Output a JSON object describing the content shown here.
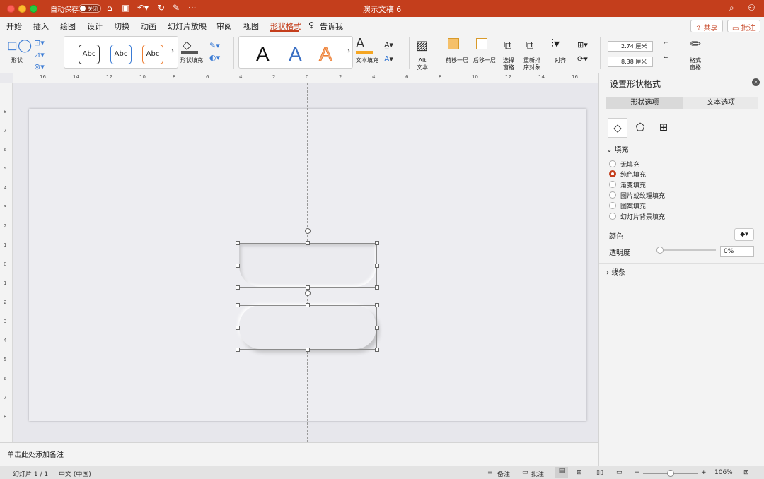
{
  "titlebar": {
    "autosave_label": "自动保存",
    "toggle_text": "关闭",
    "doc_title": "演示文稿 6",
    "more": "···"
  },
  "menu": {
    "tabs": [
      "开始",
      "插入",
      "绘图",
      "设计",
      "切换",
      "动画",
      "幻灯片放映",
      "审阅",
      "视图",
      "形状格式"
    ],
    "tell_me": "告诉我",
    "share": "共享",
    "comments": "批注"
  },
  "ribbon": {
    "shape_label": "形状",
    "style_samples": [
      "Abc",
      "Abc",
      "Abc"
    ],
    "shape_fill": "形状填充",
    "wordart": [
      "A",
      "A",
      "A"
    ],
    "text_fill": "文本填充",
    "alt_text": "Alt\n文本",
    "bring_forward": "前移一层",
    "send_backward": "后移一层",
    "selection_pane": "选择\n窗格",
    "reorder": "重新排\n序对象",
    "align": "对齐",
    "height": "2.74 厘米",
    "width": "8.38 厘米",
    "format_pane": "格式\n窗格"
  },
  "ruler": {
    "h_ticks": [
      "16",
      "14",
      "12",
      "10",
      "8",
      "6",
      "4",
      "2",
      "0",
      "2",
      "4",
      "6",
      "8",
      "10",
      "12",
      "14",
      "16"
    ],
    "v_ticks": [
      "8",
      "7",
      "6",
      "5",
      "4",
      "3",
      "2",
      "1",
      "0",
      "1",
      "2",
      "3",
      "4",
      "5",
      "6",
      "7",
      "8"
    ]
  },
  "notes_placeholder": "单击此处添加备注",
  "status": {
    "slide": "幻灯片 1 / 1",
    "lang": "中文 (中国)",
    "notes": "备注",
    "comments": "批注",
    "zoom": "106%"
  },
  "pane": {
    "title": "设置形状格式",
    "tabs": [
      "形状选项",
      "文本选项"
    ],
    "fill_section": "填充",
    "fill_options": [
      "无填充",
      "纯色填充",
      "渐变填充",
      "图片或纹理填充",
      "图案填充",
      "幻灯片背景填充"
    ],
    "selected_fill": "纯色填充",
    "color_label": "颜色",
    "transparency_label": "透明度",
    "transparency": "0%",
    "line_section": "线条"
  },
  "colors": {
    "accent": "#c43e1c",
    "titlebar": "#c43e1c"
  }
}
